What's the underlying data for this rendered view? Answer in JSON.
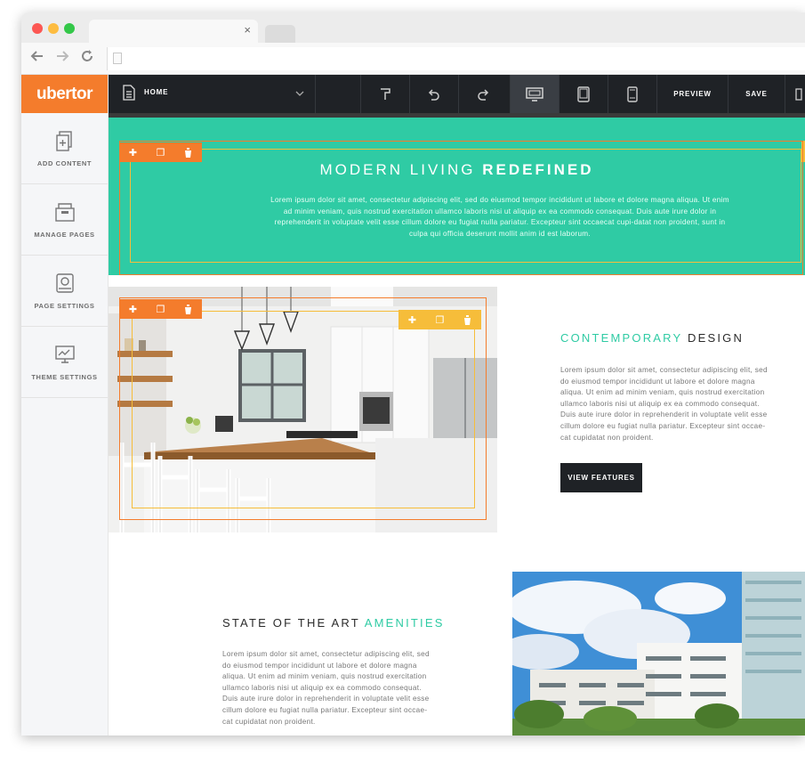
{
  "browser": {
    "close_glyph": "×"
  },
  "sidebar": {
    "logo": "ubertor",
    "items": [
      {
        "label": "ADD CONTENT",
        "icon": "add-content-icon"
      },
      {
        "label": "MANAGE PAGES",
        "icon": "manage-pages-icon"
      },
      {
        "label": "PAGE SETTINGS",
        "icon": "page-settings-icon"
      },
      {
        "label": "THEME SETTINGS",
        "icon": "theme-settings-icon"
      }
    ]
  },
  "toolbar": {
    "page_select": "HOME",
    "preview_label": "PREVIEW",
    "save_label": "SAVE"
  },
  "hero": {
    "title_light": "MODERN LIVING",
    "title_bold": "REDEFINED",
    "text": "Lorem ipsum dolor sit amet, consectetur adipiscing elit, sed do eiusmod tempor incididunt ut labore et dolore magna aliqua. Ut enim ad minim veniam, quis nostrud exercitation ullamco laboris nisi ut aliquip ex ea commodo consequat. Duis aute irure dolor in reprehenderit in voluptate velit esse cillum dolore eu fugiat nulla pariatur. Excepteur sint occaecat cupi-datat non proident, sunt in culpa qui officia deserunt mollit anim id est laborum."
  },
  "section_design": {
    "title_accent": "CONTEMPORARY",
    "title_rest": "DESIGN",
    "lines": [
      "Lorem ipsum dolor sit amet, consectetur adipiscing elit, sed",
      "do eiusmod tempor incididunt ut labore et dolore magna",
      "aliqua. Ut enim ad minim veniam, quis nostrud exercitation",
      "ullamco laboris nisi ut aliquip ex ea commodo consequat.",
      "Duis aute irure dolor in reprehenderit in voluptate velit esse",
      "cillum dolore eu fugiat nulla pariatur. Excepteur sint occae-",
      "cat cupidatat non proident."
    ],
    "button_label": "VIEW FEATURES"
  },
  "section_amenities": {
    "title_rest": "STATE OF THE ART",
    "title_accent": "AMENITIES",
    "lines": [
      "Lorem ipsum dolor sit amet, consectetur adipiscing elit, sed",
      "do eiusmod tempor incididunt ut labore et dolore magna",
      "aliqua. Ut enim ad minim veniam, quis nostrud exercitation",
      "ullamco laboris nisi ut aliquip ex ea commodo consequat.",
      "Duis aute irure dolor in reprehenderit in voluptate velit esse",
      "cillum dolore eu fugiat nulla pariatur. Excepteur sint occae-",
      "cat cupidatat non proident."
    ]
  },
  "colors": {
    "brand_orange": "#f47c2c",
    "accent_teal": "#2fcba4",
    "frame_yellow": "#f6bd3a",
    "toolbar_dark": "#1f2226"
  }
}
